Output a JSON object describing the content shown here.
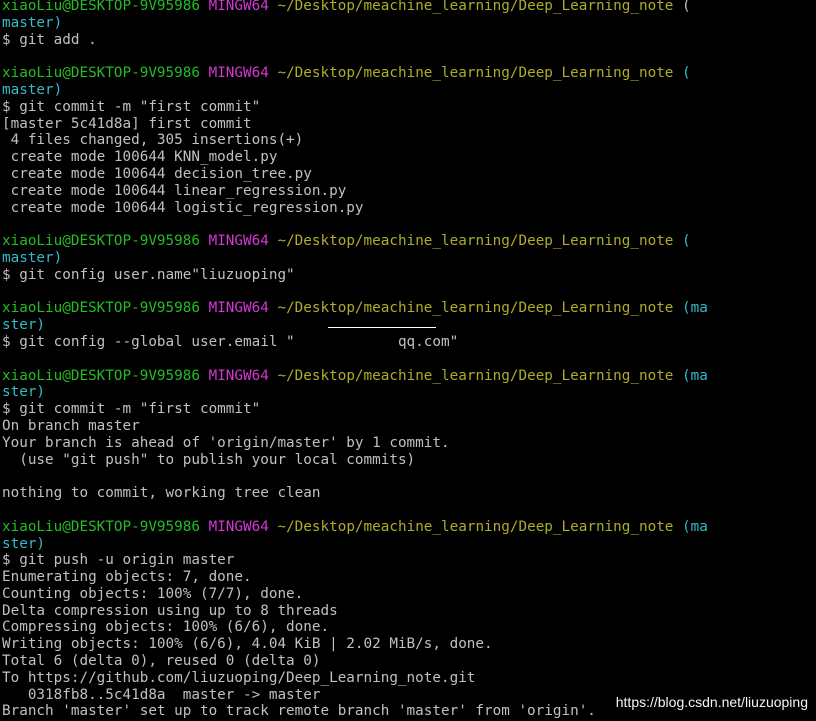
{
  "terminal": {
    "prompt": {
      "user_host": "xiaoLiu@DESKTOP-9V95986",
      "shell": "MINGW64",
      "path": "~/Desktop/meachine_learning/Deep_Learning_note"
    },
    "lines": [
      [
        {
          "t": "xiaoLiu@DESKTOP-9V95986",
          "c": "u"
        },
        {
          "t": " "
        },
        {
          "t": "MINGW64",
          "c": "m"
        },
        {
          "t": " "
        },
        {
          "t": "~/Desktop/meachine_learning/Deep_Learning_note",
          "c": "p"
        },
        {
          "t": " ("
        },
        {
          "t": "",
          "c": "b"
        }
      ],
      [
        {
          "t": "master)",
          "c": "b"
        }
      ],
      [
        {
          "t": "$ git add ."
        }
      ],
      [
        {
          "t": ""
        }
      ],
      [
        {
          "t": "xiaoLiu@DESKTOP-9V95986",
          "c": "u"
        },
        {
          "t": " "
        },
        {
          "t": "MINGW64",
          "c": "m"
        },
        {
          "t": " "
        },
        {
          "t": "~/Desktop/meachine_learning/Deep_Learning_note",
          "c": "p"
        },
        {
          "t": " (",
          "c": "b"
        }
      ],
      [
        {
          "t": "master)",
          "c": "b"
        }
      ],
      [
        {
          "t": "$ git commit -m \"first commit\""
        }
      ],
      [
        {
          "t": "[master 5c41d8a] first commit"
        }
      ],
      [
        {
          "t": " 4 files changed, 305 insertions(+)"
        }
      ],
      [
        {
          "t": " create mode 100644 KNN_model.py"
        }
      ],
      [
        {
          "t": " create mode 100644 decision_tree.py"
        }
      ],
      [
        {
          "t": " create mode 100644 linear_regression.py"
        }
      ],
      [
        {
          "t": " create mode 100644 logistic_regression.py"
        }
      ],
      [
        {
          "t": ""
        }
      ],
      [
        {
          "t": "xiaoLiu@DESKTOP-9V95986",
          "c": "u"
        },
        {
          "t": " "
        },
        {
          "t": "MINGW64",
          "c": "m"
        },
        {
          "t": " "
        },
        {
          "t": "~/Desktop/meachine_learning/Deep_Learning_note",
          "c": "p"
        },
        {
          "t": " (",
          "c": "b"
        }
      ],
      [
        {
          "t": "master)",
          "c": "b"
        }
      ],
      [
        {
          "t": "$ git config user.name\"liuzuoping\""
        }
      ],
      [
        {
          "t": ""
        }
      ],
      [
        {
          "t": "xiaoLiu@DESKTOP-9V95986",
          "c": "u"
        },
        {
          "t": " "
        },
        {
          "t": "MINGW64",
          "c": "m"
        },
        {
          "t": " "
        },
        {
          "t": "~/Desktop/meachine_learning/Deep_Learning_note",
          "c": "p"
        },
        {
          "t": " (ma",
          "c": "b"
        }
      ],
      [
        {
          "t": "ster)",
          "c": "b"
        }
      ],
      [
        {
          "t": "$ git config --global user.email \"            qq.com\""
        }
      ],
      [
        {
          "t": ""
        }
      ],
      [
        {
          "t": "xiaoLiu@DESKTOP-9V95986",
          "c": "u"
        },
        {
          "t": " "
        },
        {
          "t": "MINGW64",
          "c": "m"
        },
        {
          "t": " "
        },
        {
          "t": "~/Desktop/meachine_learning/Deep_Learning_note",
          "c": "p"
        },
        {
          "t": " (ma",
          "c": "b"
        }
      ],
      [
        {
          "t": "ster)",
          "c": "b"
        }
      ],
      [
        {
          "t": "$ git commit -m \"first commit\""
        }
      ],
      [
        {
          "t": "On branch master"
        }
      ],
      [
        {
          "t": "Your branch is ahead of 'origin/master' by 1 commit."
        }
      ],
      [
        {
          "t": "  (use \"git push\" to publish your local commits)"
        }
      ],
      [
        {
          "t": ""
        }
      ],
      [
        {
          "t": "nothing to commit, working tree clean"
        }
      ],
      [
        {
          "t": ""
        }
      ],
      [
        {
          "t": "xiaoLiu@DESKTOP-9V95986",
          "c": "u"
        },
        {
          "t": " "
        },
        {
          "t": "MINGW64",
          "c": "m"
        },
        {
          "t": " "
        },
        {
          "t": "~/Desktop/meachine_learning/Deep_Learning_note",
          "c": "p"
        },
        {
          "t": " (ma",
          "c": "b"
        }
      ],
      [
        {
          "t": "ster)",
          "c": "b"
        }
      ],
      [
        {
          "t": "$ git push -u origin master"
        }
      ],
      [
        {
          "t": "Enumerating objects: 7, done."
        }
      ],
      [
        {
          "t": "Counting objects: 100% (7/7), done."
        }
      ],
      [
        {
          "t": "Delta compression using up to 8 threads"
        }
      ],
      [
        {
          "t": "Compressing objects: 100% (6/6), done."
        }
      ],
      [
        {
          "t": "Writing objects: 100% (6/6), 4.04 KiB | 2.02 MiB/s, done."
        }
      ],
      [
        {
          "t": "Total 6 (delta 0), reused 0 (delta 0)"
        }
      ],
      [
        {
          "t": "To https://github.com/liuzuoping/Deep_Learning_note.git"
        }
      ],
      [
        {
          "t": "   0318fb8..5c41d8a  master -> master"
        }
      ],
      [
        {
          "t": "Branch 'master' set up to track remote branch 'master' from 'origin'."
        }
      ]
    ]
  },
  "watermark": "https://blog.csdn.net/liuzuoping",
  "colors": {
    "background": "#000000",
    "text": "#c0c0c0",
    "user_host": "#25bc24",
    "shell": "#d338d3",
    "path": "#adad27",
    "branch": "#33bbc8"
  }
}
